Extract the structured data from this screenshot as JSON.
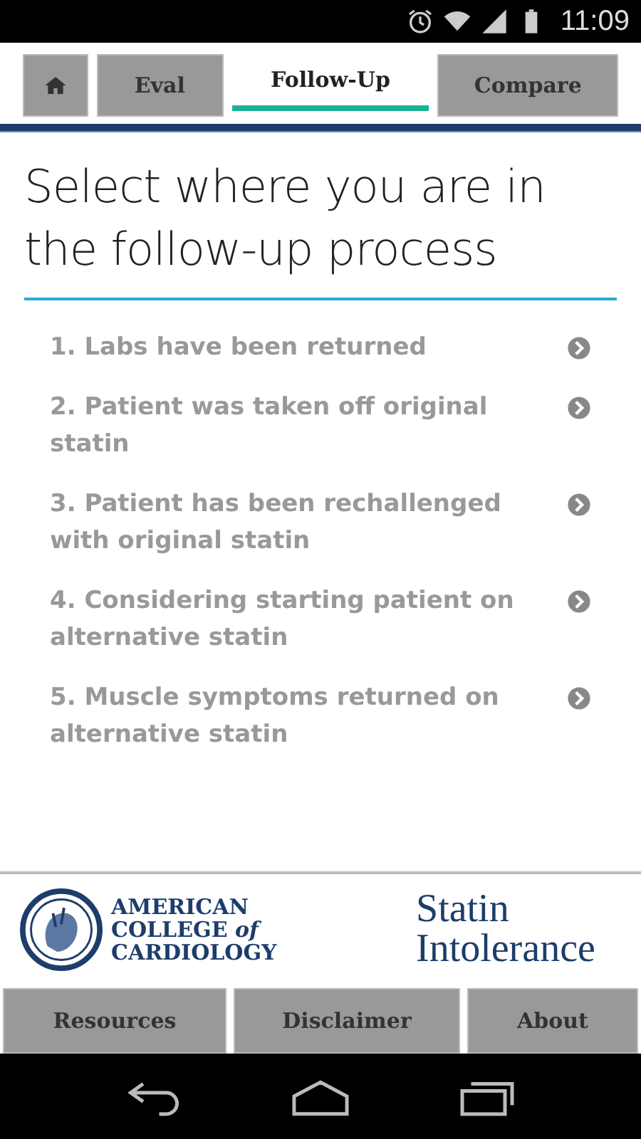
{
  "status_bar": {
    "time": "11:09"
  },
  "tabs": [
    {
      "kind": "home",
      "selected": false
    },
    {
      "kind": "text",
      "label": "Eval",
      "selected": false
    },
    {
      "kind": "text",
      "label": "Follow-Up",
      "selected": true
    },
    {
      "kind": "text",
      "label": "Compare",
      "selected": false
    }
  ],
  "heading": "Select where you are in the follow-up process",
  "steps": [
    "1. Labs have been returned",
    "2. Patient was taken off original statin",
    "3. Patient has been rechallenged with original statin",
    "4. Considering starting patient on alternative statin",
    "5. Muscle symptoms returned on alternative statin"
  ],
  "footer": {
    "org_name": "AMERICAN COLLEGE *of* CARDIOLOGY",
    "app_name": "Statin Intolerance",
    "buttons": [
      "Resources",
      "Disclaimer",
      "About"
    ]
  }
}
